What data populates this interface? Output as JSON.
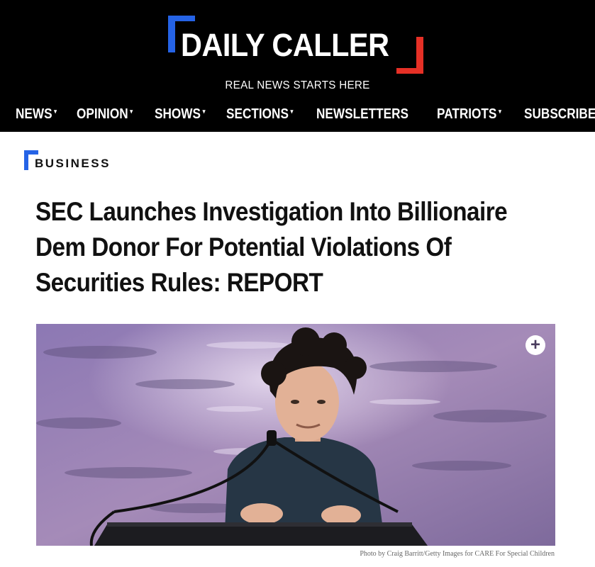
{
  "site": {
    "logo_text": "DAILY CALLER",
    "tagline": "REAL NEWS STARTS HERE",
    "brand_colors": {
      "background": "#000000",
      "blue": "#2563e6",
      "red": "#e63026"
    }
  },
  "nav": {
    "items": [
      {
        "label": "NEWS",
        "has_dropdown": true
      },
      {
        "label": "OPINION",
        "has_dropdown": true
      },
      {
        "label": "SHOWS",
        "has_dropdown": true
      },
      {
        "label": "SECTIONS",
        "has_dropdown": true
      },
      {
        "label": "NEWSLETTERS",
        "has_dropdown": false
      },
      {
        "label": "PATRIOTS",
        "has_dropdown": true
      },
      {
        "label": "SUBSCRIBE",
        "has_dropdown": false
      }
    ],
    "caret_glyph": "▾"
  },
  "article": {
    "category": "BUSINESS",
    "headline": "SEC Launches Investigation Into Billionaire Dem Donor For Potential Violations Of Securities Rules: REPORT",
    "photo": {
      "expand_icon": "plus-circle-icon",
      "expand_glyph": "+",
      "caption": "Photo by Craig Barritt/Getty Images for CARE For Special Children"
    }
  }
}
